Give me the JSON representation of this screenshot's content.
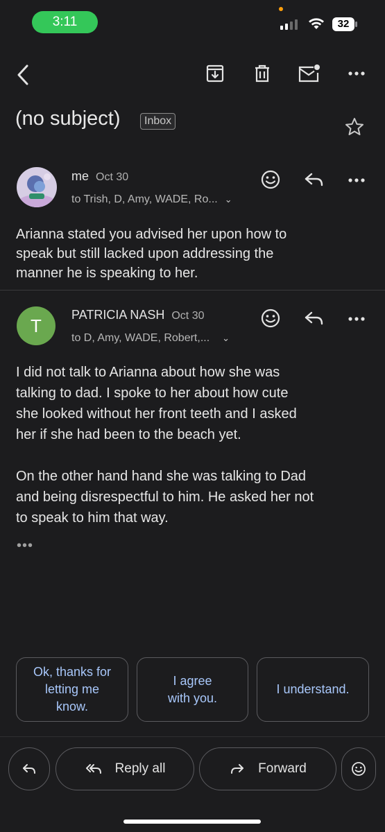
{
  "status_bar": {
    "time": "3:11",
    "battery": "32"
  },
  "header": {
    "subject": "(no subject)",
    "label_badge": "Inbox"
  },
  "messages": [
    {
      "sender": "me",
      "date": "Oct 30",
      "recipients": "to Trish, D, Amy, WADE, Ro...",
      "body": [
        "Arianna stated you advised her upon how to",
        "speak but still lacked upon addressing the",
        "manner he is speaking to her."
      ]
    },
    {
      "sender": "PATRICIA NASH",
      "date": "Oct 30",
      "avatar_letter": "T",
      "recipients": "to D, Amy, WADE, Robert,...",
      "body": [
        "I did not talk to Arianna about how she was",
        "talking to dad. I spoke to her about how cute",
        "she looked without her front teeth and I asked",
        "her if she had been to the beach yet."
      ],
      "body2": [
        "On the other hand hand she was talking to Dad",
        "and being disrespectful to him. He asked her not",
        "to speak to him that way."
      ],
      "collapsed": "•••"
    }
  ],
  "smart_replies": [
    {
      "text": [
        "Ok, thanks for",
        "letting me",
        "know."
      ]
    },
    {
      "text": [
        "I agree",
        "with you."
      ]
    },
    {
      "text": [
        "I understand."
      ]
    }
  ],
  "actions": {
    "reply_all": "Reply all",
    "forward": "Forward"
  },
  "colors": {
    "accent_link": "#a8c7fa",
    "avatar_green": "#6aa84f",
    "time_pill": "#34c759"
  },
  "icons": [
    "back-arrow-icon",
    "archive-icon",
    "trash-icon",
    "mark-unread-icon",
    "more-vert-icon",
    "star-icon",
    "emoji-icon",
    "reply-icon",
    "reply-all-icon",
    "forward-icon",
    "chevron-down-icon"
  ]
}
